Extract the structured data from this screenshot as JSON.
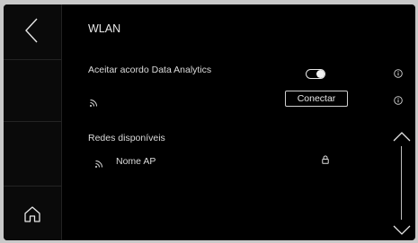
{
  "header": {
    "title": "WLAN"
  },
  "settings": {
    "analytics_label": "Aceitar acordo Data Analytics",
    "analytics_enabled": true,
    "connect_label": "Conectar"
  },
  "networks": {
    "section_label": "Redes disponíveis",
    "items": [
      {
        "name": "Nome AP",
        "secured": true
      }
    ]
  },
  "icons": {
    "back": "chevron-left-icon",
    "home": "home-icon",
    "wifi": "wifi-icon",
    "info": "info-icon",
    "lock": "lock-icon",
    "scroll_up": "chevron-up-icon",
    "scroll_down": "chevron-down-icon"
  }
}
